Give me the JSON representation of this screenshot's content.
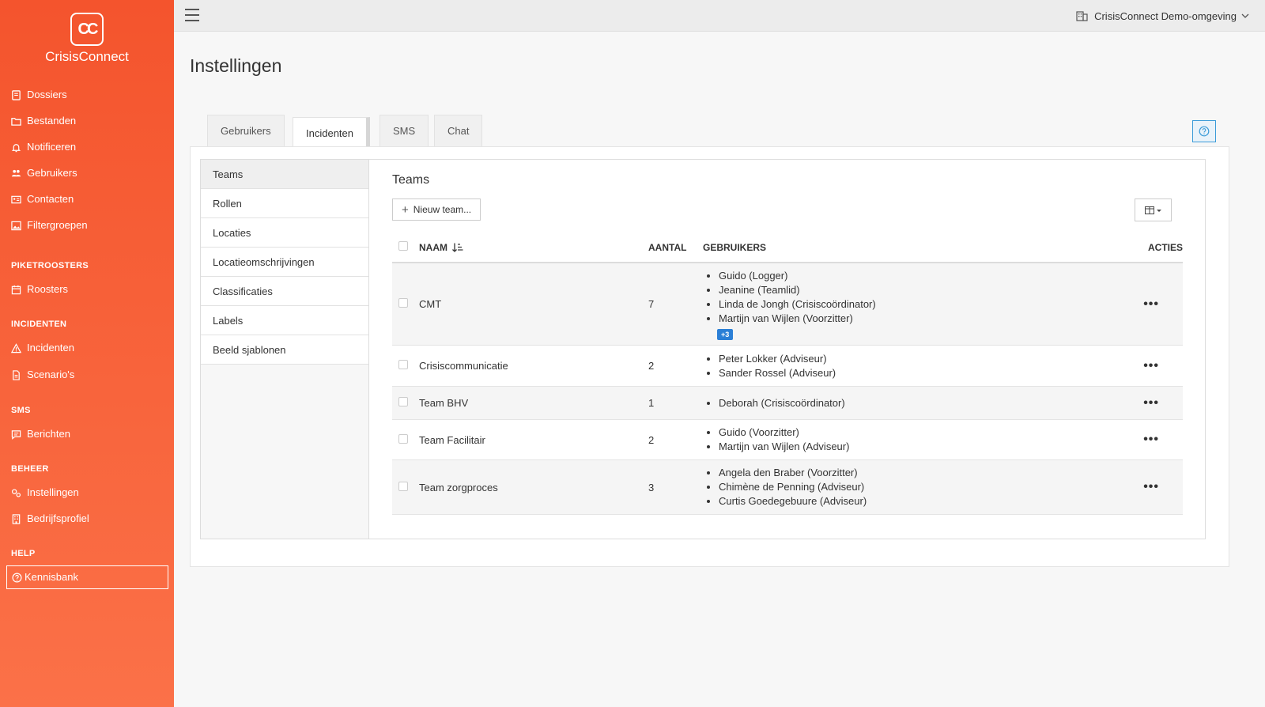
{
  "app": {
    "logo_letters": "CC",
    "name": "CrisisConnect"
  },
  "sidebar": {
    "items_top": [
      {
        "label": "Dossiers",
        "icon": "book-icon"
      },
      {
        "label": "Bestanden",
        "icon": "folder-icon"
      },
      {
        "label": "Notificeren",
        "icon": "bell-icon"
      },
      {
        "label": "Gebruikers",
        "icon": "users-icon"
      },
      {
        "label": "Contacten",
        "icon": "contact-card-icon"
      },
      {
        "label": "Filtergroepen",
        "icon": "image-icon"
      }
    ],
    "groups": [
      {
        "title": "PIKETROOSTERS",
        "items": [
          {
            "label": "Roosters",
            "icon": "calendar-icon"
          }
        ]
      },
      {
        "title": "INCIDENTEN",
        "items": [
          {
            "label": "Incidenten",
            "icon": "warning-icon"
          },
          {
            "label": "Scenario's",
            "icon": "document-icon"
          }
        ]
      },
      {
        "title": "SMS",
        "items": [
          {
            "label": "Berichten",
            "icon": "message-icon"
          }
        ]
      },
      {
        "title": "BEHEER",
        "items": [
          {
            "label": "Instellingen",
            "icon": "settings-icon"
          },
          {
            "label": "Bedrijfsprofiel",
            "icon": "building-icon"
          }
        ]
      },
      {
        "title": "HELP",
        "items": [
          {
            "label": "Kennisbank",
            "icon": "help-circle-icon"
          }
        ]
      }
    ]
  },
  "topbar": {
    "org_label": "CrisisConnect Demo-omgeving"
  },
  "page": {
    "title": "Instellingen",
    "tabs": [
      "Gebruikers",
      "Incidenten",
      "SMS",
      "Chat"
    ],
    "active_tab": "Incidenten"
  },
  "subnav": {
    "items": [
      "Teams",
      "Rollen",
      "Locaties",
      "Locatieomschrijvingen",
      "Classificaties",
      "Labels",
      "Beeld sjablonen"
    ],
    "active": "Teams"
  },
  "teams": {
    "title": "Teams",
    "new_button_label": "Nieuw team...",
    "columns": {
      "naam": "NAAM",
      "aantal": "AANTAL",
      "gebruikers": "GEBRUIKERS",
      "acties": "ACTIES"
    },
    "rows": [
      {
        "naam": "CMT",
        "aantal": "7",
        "gebruikers": [
          "Guido (Logger)",
          "Jeanine (Teamlid)",
          "Linda de Jongh (Crisiscoördinator)",
          "Martijn van Wijlen (Voorzitter)"
        ],
        "more": "+3"
      },
      {
        "naam": "Crisiscommunicatie",
        "aantal": "2",
        "gebruikers": [
          "Peter Lokker (Adviseur)",
          "Sander Rossel (Adviseur)"
        ]
      },
      {
        "naam": "Team BHV",
        "aantal": "1",
        "gebruikers": [
          "Deborah (Crisiscoördinator)"
        ]
      },
      {
        "naam": "Team Facilitair",
        "aantal": "2",
        "gebruikers": [
          "Guido (Voorzitter)",
          "Martijn van Wijlen (Adviseur)"
        ]
      },
      {
        "naam": "Team zorgproces",
        "aantal": "3",
        "gebruikers": [
          "Angela den Braber (Voorzitter)",
          "Chimène de Penning (Adviseur)",
          "Curtis Goedegebuure (Adviseur)"
        ]
      }
    ],
    "actions_symbol": "•••"
  },
  "colors": {
    "sidebar_top": "#f4542d",
    "sidebar_bottom": "#fb7148",
    "badge": "#2b7fd6",
    "help_button": "#3a9bd8"
  }
}
